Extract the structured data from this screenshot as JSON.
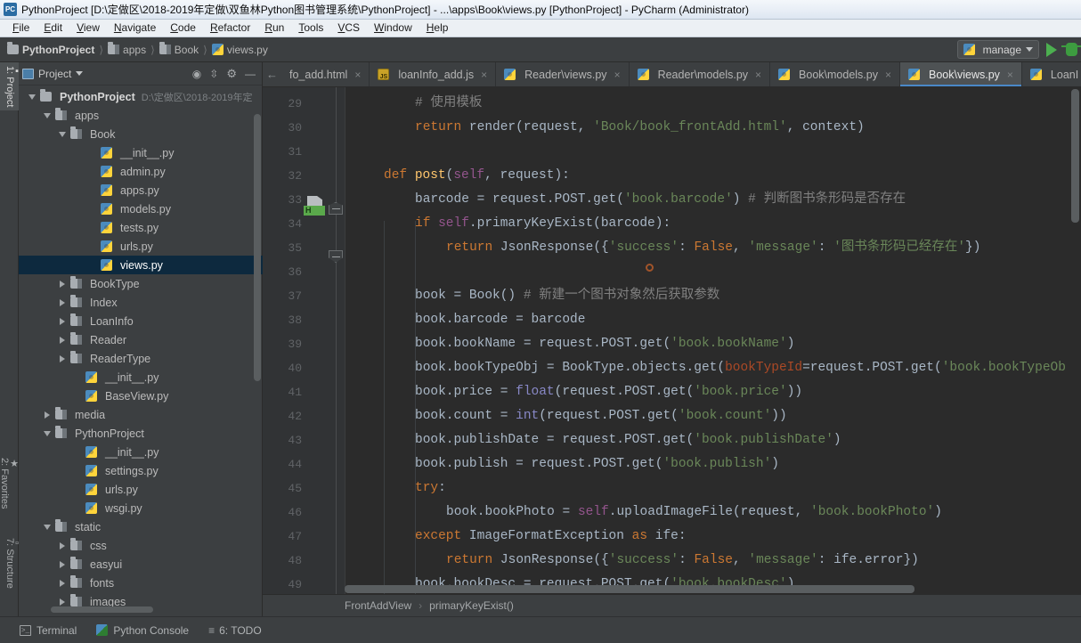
{
  "window": {
    "icon": "pycharm-app-icon",
    "title": "PythonProject [D:\\定做区\\2018-2019年定做\\双鱼林Python图书管理系统\\PythonProject] - ...\\apps\\Book\\views.py [PythonProject] - PyCharm (Administrator)"
  },
  "menubar": {
    "items": [
      {
        "label": "File"
      },
      {
        "label": "Edit"
      },
      {
        "label": "View"
      },
      {
        "label": "Navigate"
      },
      {
        "label": "Code"
      },
      {
        "label": "Refactor"
      },
      {
        "label": "Run"
      },
      {
        "label": "Tools"
      },
      {
        "label": "VCS"
      },
      {
        "label": "Window"
      },
      {
        "label": "Help"
      }
    ]
  },
  "navbar": {
    "breadcrumbs": [
      {
        "label": "PythonProject",
        "icon": "folder-icon"
      },
      {
        "label": "apps",
        "icon": "module-folder-icon"
      },
      {
        "label": "Book",
        "icon": "module-folder-icon"
      },
      {
        "label": "views.py",
        "icon": "python-file-icon"
      }
    ],
    "run_config": {
      "label": "manage",
      "icon": "python-file-icon",
      "caret": "chevron-down-icon"
    },
    "run_button": "run-icon",
    "debug_button": "debug-icon"
  },
  "left_tool_strip": {
    "tabs": [
      {
        "label": "1: Project",
        "active": true
      },
      {
        "label": "2: Favorites",
        "active": false
      },
      {
        "label": "7: Structure",
        "active": false
      }
    ]
  },
  "project_panel": {
    "title": "Project",
    "caret": "chevron-down-icon",
    "tools": [
      "locate-icon",
      "collapse-all-icon",
      "settings-gear-icon",
      "hide-icon"
    ],
    "tree": [
      {
        "depth": 0,
        "twisty": "down",
        "icon": "folder-icon",
        "label": "PythonProject",
        "bold": true,
        "path": "D:\\定做区\\2018-2019年定",
        "selected": false
      },
      {
        "depth": 1,
        "twisty": "down",
        "icon": "module-folder-icon",
        "label": "apps",
        "selected": false
      },
      {
        "depth": 2,
        "twisty": "down",
        "icon": "module-folder-icon",
        "label": "Book",
        "selected": false
      },
      {
        "depth": 4,
        "twisty": "none",
        "icon": "python-file-icon",
        "label": "__init__.py",
        "selected": false
      },
      {
        "depth": 4,
        "twisty": "none",
        "icon": "python-file-icon",
        "label": "admin.py",
        "selected": false
      },
      {
        "depth": 4,
        "twisty": "none",
        "icon": "python-file-icon",
        "label": "apps.py",
        "selected": false
      },
      {
        "depth": 4,
        "twisty": "none",
        "icon": "python-file-icon",
        "label": "models.py",
        "selected": false
      },
      {
        "depth": 4,
        "twisty": "none",
        "icon": "python-file-icon",
        "label": "tests.py",
        "selected": false
      },
      {
        "depth": 4,
        "twisty": "none",
        "icon": "python-file-icon",
        "label": "urls.py",
        "selected": false
      },
      {
        "depth": 4,
        "twisty": "none",
        "icon": "python-file-icon",
        "label": "views.py",
        "selected": true
      },
      {
        "depth": 2,
        "twisty": "right",
        "icon": "module-folder-icon",
        "label": "BookType",
        "selected": false
      },
      {
        "depth": 2,
        "twisty": "right",
        "icon": "module-folder-icon",
        "label": "Index",
        "selected": false
      },
      {
        "depth": 2,
        "twisty": "right",
        "icon": "module-folder-icon",
        "label": "LoanInfo",
        "selected": false
      },
      {
        "depth": 2,
        "twisty": "right",
        "icon": "module-folder-icon",
        "label": "Reader",
        "selected": false
      },
      {
        "depth": 2,
        "twisty": "right",
        "icon": "module-folder-icon",
        "label": "ReaderType",
        "selected": false
      },
      {
        "depth": 3,
        "twisty": "none",
        "icon": "python-file-icon",
        "label": "__init__.py",
        "selected": false
      },
      {
        "depth": 3,
        "twisty": "none",
        "icon": "python-file-icon",
        "label": "BaseView.py",
        "selected": false
      },
      {
        "depth": 1,
        "twisty": "right",
        "icon": "module-folder-icon",
        "label": "media",
        "selected": false
      },
      {
        "depth": 1,
        "twisty": "down",
        "icon": "module-folder-icon",
        "label": "PythonProject",
        "selected": false
      },
      {
        "depth": 3,
        "twisty": "none",
        "icon": "python-file-icon",
        "label": "__init__.py",
        "selected": false
      },
      {
        "depth": 3,
        "twisty": "none",
        "icon": "python-file-icon",
        "label": "settings.py",
        "selected": false
      },
      {
        "depth": 3,
        "twisty": "none",
        "icon": "python-file-icon",
        "label": "urls.py",
        "selected": false
      },
      {
        "depth": 3,
        "twisty": "none",
        "icon": "python-file-icon",
        "label": "wsgi.py",
        "selected": false
      },
      {
        "depth": 1,
        "twisty": "down",
        "icon": "module-folder-icon",
        "label": "static",
        "selected": false
      },
      {
        "depth": 2,
        "twisty": "right",
        "icon": "module-folder-icon",
        "label": "css",
        "selected": false
      },
      {
        "depth": 2,
        "twisty": "right",
        "icon": "module-folder-icon",
        "label": "easyui",
        "selected": false
      },
      {
        "depth": 2,
        "twisty": "right",
        "icon": "module-folder-icon",
        "label": "fonts",
        "selected": false
      },
      {
        "depth": 2,
        "twisty": "right",
        "icon": "module-folder-icon",
        "label": "images",
        "selected": false
      }
    ]
  },
  "editor_tabs": {
    "scroll_left_icon": "chevron-left-icon",
    "tabs": [
      {
        "label": "fo_add.html",
        "icon": "html-file-icon",
        "active": false,
        "close": "×"
      },
      {
        "label": "loanInfo_add.js",
        "icon": "js-file-icon",
        "active": false,
        "close": "×"
      },
      {
        "label": "Reader\\views.py",
        "icon": "python-file-icon",
        "active": false,
        "close": "×"
      },
      {
        "label": "Reader\\models.py",
        "icon": "python-file-icon",
        "active": false,
        "close": "×"
      },
      {
        "label": "Book\\models.py",
        "icon": "python-file-icon",
        "active": false,
        "close": "×"
      },
      {
        "label": "Book\\views.py",
        "icon": "python-file-icon",
        "active": true,
        "close": "×"
      },
      {
        "label": "LoanI",
        "icon": "python-file-icon",
        "active": false,
        "close": ""
      }
    ]
  },
  "editor": {
    "first_line": 29,
    "line_numbers": [
      29,
      30,
      31,
      32,
      33,
      34,
      35,
      36,
      37,
      38,
      39,
      40,
      41,
      42,
      43,
      44,
      45,
      46,
      47,
      48,
      49
    ],
    "gutter_marks": [
      {
        "line": 30,
        "type": "html-template-marker",
        "badge": "H"
      },
      {
        "line": 30,
        "type": "fold-end-marker"
      },
      {
        "line": 32,
        "type": "fold-start-marker"
      }
    ],
    "breakpoint_hint": {
      "line": 32,
      "type": "method-marker-icon"
    },
    "lines": [
      {
        "n": 29,
        "indent": 2,
        "tokens": [
          {
            "t": "# 使用模板",
            "c": "cmt"
          }
        ]
      },
      {
        "n": 30,
        "indent": 2,
        "tokens": [
          {
            "t": "return",
            "c": "kw"
          },
          {
            "t": " render(request, ",
            "c": "plain"
          },
          {
            "t": "'Book/book_frontAdd.html'",
            "c": "str"
          },
          {
            "t": ", context)",
            "c": "plain"
          }
        ]
      },
      {
        "n": 31,
        "indent": 0,
        "tokens": []
      },
      {
        "n": 32,
        "indent": 1,
        "tokens": [
          {
            "t": "def ",
            "c": "kw"
          },
          {
            "t": "post",
            "c": "fn"
          },
          {
            "t": "(",
            "c": "plain"
          },
          {
            "t": "self",
            "c": "self"
          },
          {
            "t": ", request):",
            "c": "plain"
          }
        ]
      },
      {
        "n": 33,
        "indent": 2,
        "tokens": [
          {
            "t": "barcode = request.POST.get(",
            "c": "plain"
          },
          {
            "t": "'book.barcode'",
            "c": "str"
          },
          {
            "t": ")",
            "c": "plain"
          },
          {
            "t": "  # 判断图书条形码是否存在",
            "c": "cmt"
          }
        ]
      },
      {
        "n": 34,
        "indent": 2,
        "tokens": [
          {
            "t": "if ",
            "c": "kw"
          },
          {
            "t": "self",
            "c": "self"
          },
          {
            "t": ".primaryKeyExist(barcode):",
            "c": "plain"
          }
        ]
      },
      {
        "n": 35,
        "indent": 3,
        "tokens": [
          {
            "t": "return",
            "c": "kw"
          },
          {
            "t": " JsonResponse({",
            "c": "plain"
          },
          {
            "t": "'success'",
            "c": "str"
          },
          {
            "t": ": ",
            "c": "plain"
          },
          {
            "t": "False",
            "c": "kw"
          },
          {
            "t": ", ",
            "c": "plain"
          },
          {
            "t": "'message'",
            "c": "str"
          },
          {
            "t": ": ",
            "c": "plain"
          },
          {
            "t": "'图书条形码已经存在'",
            "c": "str"
          },
          {
            "t": "})",
            "c": "plain"
          }
        ]
      },
      {
        "n": 36,
        "indent": 0,
        "tokens": []
      },
      {
        "n": 37,
        "indent": 2,
        "tokens": [
          {
            "t": "book = Book()",
            "c": "plain"
          },
          {
            "t": "  # 新建一个图书对象然后获取参数",
            "c": "cmt"
          }
        ]
      },
      {
        "n": 38,
        "indent": 2,
        "tokens": [
          {
            "t": "book.barcode = barcode",
            "c": "plain"
          }
        ]
      },
      {
        "n": 39,
        "indent": 2,
        "tokens": [
          {
            "t": "book.bookName = request.POST.get(",
            "c": "plain"
          },
          {
            "t": "'book.bookName'",
            "c": "str"
          },
          {
            "t": ")",
            "c": "plain"
          }
        ]
      },
      {
        "n": 40,
        "indent": 2,
        "tokens": [
          {
            "t": "book.bookTypeObj = BookType.objects.get(",
            "c": "plain"
          },
          {
            "t": "bookTypeId",
            "c": "kwarg"
          },
          {
            "t": "=request.POST.get(",
            "c": "plain"
          },
          {
            "t": "'book.bookTypeOb",
            "c": "str"
          }
        ]
      },
      {
        "n": 41,
        "indent": 2,
        "tokens": [
          {
            "t": "book.price = ",
            "c": "plain"
          },
          {
            "t": "float",
            "c": "bi"
          },
          {
            "t": "(request.POST.get(",
            "c": "plain"
          },
          {
            "t": "'book.price'",
            "c": "str"
          },
          {
            "t": "))",
            "c": "plain"
          }
        ]
      },
      {
        "n": 42,
        "indent": 2,
        "tokens": [
          {
            "t": "book.count = ",
            "c": "plain"
          },
          {
            "t": "int",
            "c": "bi"
          },
          {
            "t": "(request.POST.get(",
            "c": "plain"
          },
          {
            "t": "'book.count'",
            "c": "str"
          },
          {
            "t": "))",
            "c": "plain"
          }
        ]
      },
      {
        "n": 43,
        "indent": 2,
        "tokens": [
          {
            "t": "book.publishDate = request.POST.get(",
            "c": "plain"
          },
          {
            "t": "'book.publishDate'",
            "c": "str"
          },
          {
            "t": ")",
            "c": "plain"
          }
        ]
      },
      {
        "n": 44,
        "indent": 2,
        "tokens": [
          {
            "t": "book.publish = request.POST.get(",
            "c": "plain"
          },
          {
            "t": "'book.publish'",
            "c": "str"
          },
          {
            "t": ")",
            "c": "plain"
          }
        ]
      },
      {
        "n": 45,
        "indent": 2,
        "tokens": [
          {
            "t": "try",
            "c": "kw"
          },
          {
            "t": ":",
            "c": "plain"
          }
        ]
      },
      {
        "n": 46,
        "indent": 3,
        "tokens": [
          {
            "t": "book.bookPhoto = ",
            "c": "plain"
          },
          {
            "t": "self",
            "c": "self"
          },
          {
            "t": ".uploadImageFile(request,",
            "c": "plain"
          },
          {
            "t": " 'book.bookPhoto'",
            "c": "str"
          },
          {
            "t": ")",
            "c": "plain"
          }
        ]
      },
      {
        "n": 47,
        "indent": 2,
        "tokens": [
          {
            "t": "except ",
            "c": "kw"
          },
          {
            "t": "ImageFormatException ",
            "c": "plain"
          },
          {
            "t": "as ",
            "c": "kw"
          },
          {
            "t": "ife:",
            "c": "plain"
          }
        ]
      },
      {
        "n": 48,
        "indent": 3,
        "tokens": [
          {
            "t": "return",
            "c": "kw"
          },
          {
            "t": " JsonResponse({",
            "c": "plain"
          },
          {
            "t": "'success'",
            "c": "str"
          },
          {
            "t": ": ",
            "c": "plain"
          },
          {
            "t": "False",
            "c": "kw"
          },
          {
            "t": ", ",
            "c": "plain"
          },
          {
            "t": "'message'",
            "c": "str"
          },
          {
            "t": ": ife.error})",
            "c": "plain"
          }
        ]
      },
      {
        "n": 49,
        "indent": 2,
        "tokens": [
          {
            "t": "book.bookDesc = request.POST.get(",
            "c": "plain"
          },
          {
            "t": "'book.bookDesc'",
            "c": "str"
          },
          {
            "t": ")",
            "c": "plain"
          }
        ]
      }
    ]
  },
  "editor_breadcrumb": {
    "items": [
      "FrontAddView",
      "primaryKeyExist()"
    ],
    "separator": "›"
  },
  "bottom_bar": {
    "items": [
      {
        "label": "Terminal",
        "icon": "terminal-icon"
      },
      {
        "label": "Python Console",
        "icon": "python-console-icon"
      },
      {
        "label": "6: TODO",
        "icon": "todo-list-icon"
      }
    ]
  },
  "colors": {
    "chrome": "#3c3f41",
    "editor_bg": "#2b2b2b",
    "gutter_bg": "#313335",
    "selection": "#0d293e",
    "accent": "#4a88c7",
    "keyword": "#cc7832",
    "string": "#6a8759",
    "comment": "#808080",
    "function": "#ffc66d",
    "self": "#94558d",
    "builtin": "#8888c6",
    "kwarg": "#aa4926"
  }
}
